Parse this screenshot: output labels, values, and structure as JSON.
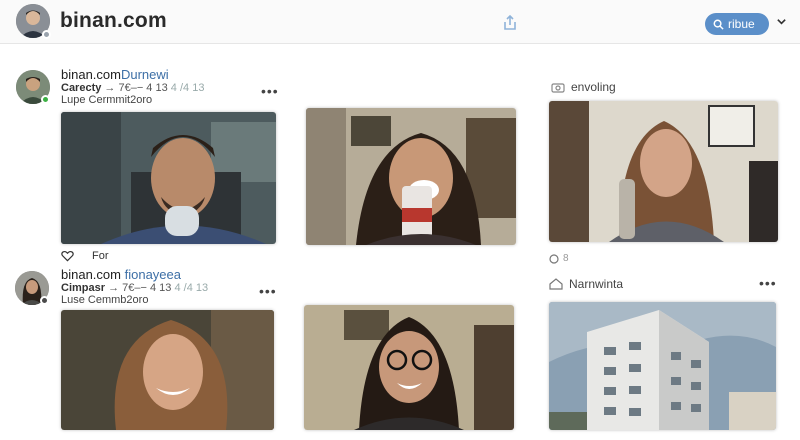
{
  "header": {
    "site_title": "binan.com",
    "search_label": "ribue"
  },
  "posts": [
    {
      "name_main": "binan.com",
      "name_accent": "Durnewi",
      "line_bold": "Carecty",
      "line_meta": "→ 7€–− 4 13",
      "line_faint": "4 /4 13",
      "sub": "Lupe Cermmit2oro"
    },
    {
      "name_main": "binan.com",
      "name_accent": "fionayeea",
      "line_bold": "Cimpasr",
      "line_meta": "→ 7€–− 4 13",
      "line_faint": "4 /4 13",
      "sub": "Luse Cemmb2oro"
    }
  ],
  "side_labels": {
    "top": "envoling",
    "bottom": "Narnwinta"
  },
  "reactions": {
    "like_label": "For",
    "small_count": "8"
  },
  "menu_glyph": "•••",
  "colors": {
    "accent": "#3d6fa6",
    "search_pill": "#5b8fc9",
    "online": "#3cb043"
  }
}
